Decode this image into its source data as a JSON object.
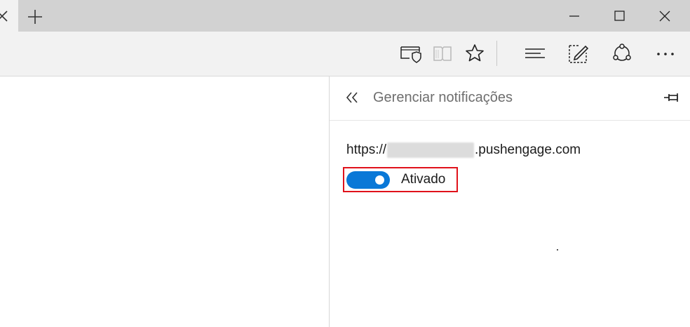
{
  "titlebar": {
    "tab_close_icon": "close-icon",
    "new_tab_icon": "plus-icon",
    "window_controls": [
      "minimize-icon",
      "maximize-icon",
      "close-icon"
    ]
  },
  "toolbar": {
    "icons": [
      "reading-view-shield-icon",
      "book-icon",
      "favorite-star-icon",
      "hub-icon",
      "web-note-icon",
      "share-icon",
      "more-icon"
    ]
  },
  "panel": {
    "back_icon": "double-chevron-left-icon",
    "title": "Gerenciar notificações",
    "pin_icon": "pin-icon",
    "site_url_prefix": "https://",
    "site_url_suffix": ".pushengage.com",
    "toggle_label": "Ativado",
    "toggle_on": true
  },
  "colors": {
    "toggle_on": "#0a78d7",
    "highlight": "#e0121b",
    "titlebar_bg": "#d2d2d2",
    "toolbar_bg": "#f2f2f2"
  }
}
